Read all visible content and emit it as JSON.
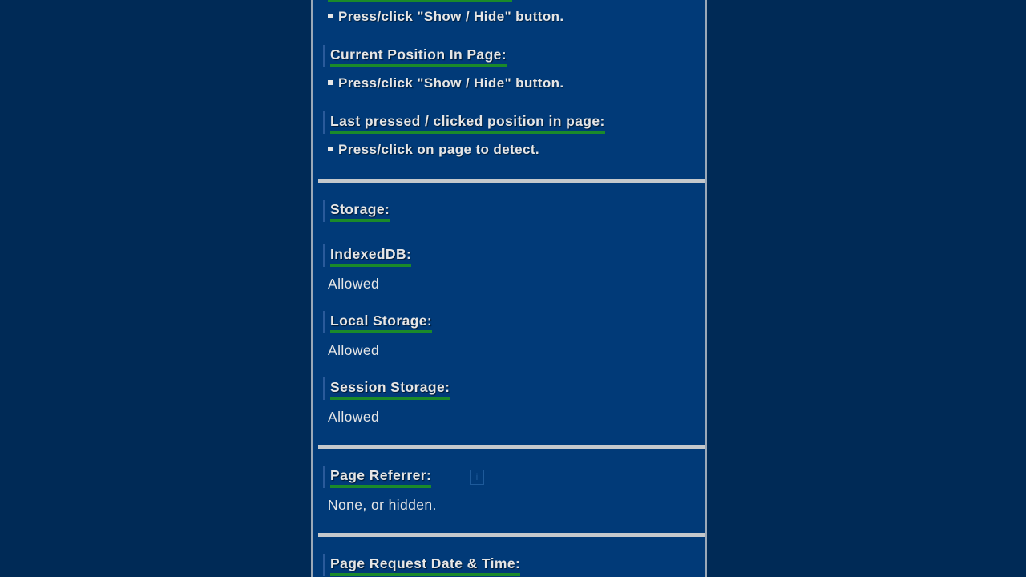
{
  "sections": {
    "show_hide_hint": "Press/click \"Show / Hide\" button.",
    "current_position": {
      "heading": "Current Position In Page:",
      "hint": "Press/click \"Show / Hide\" button."
    },
    "last_pressed": {
      "heading": "Last pressed / clicked position in page:",
      "hint": "Press/click on page to detect."
    },
    "storage": {
      "heading": "Storage:",
      "indexeddb": {
        "heading": "IndexedDB:",
        "value": "Allowed"
      },
      "local_storage": {
        "heading": "Local Storage:",
        "value": "Allowed"
      },
      "session_storage": {
        "heading": "Session Storage:",
        "value": "Allowed"
      }
    },
    "page_referrer": {
      "heading": "Page Referrer:",
      "info_icon": "info-icon",
      "info_glyph": "i",
      "value": "None, or hidden."
    },
    "page_request": {
      "heading": "Page Request Date & Time:"
    }
  },
  "colors": {
    "page_background": "#002a56",
    "panel_background": "#013a78",
    "underline": "#1b8a2a",
    "divider": "#c4c8cc",
    "text": "#e6e6e6"
  }
}
